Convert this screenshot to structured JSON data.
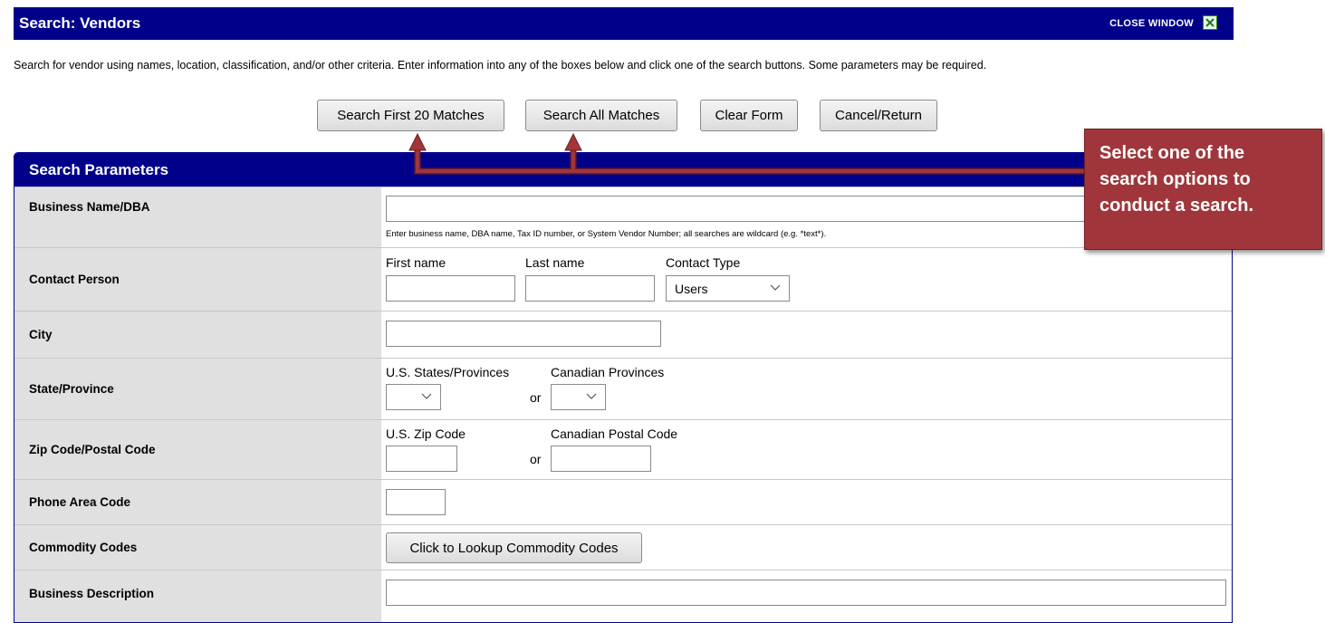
{
  "window": {
    "title": "Search: Vendors",
    "close_label": "CLOSE WINDOW",
    "close_icon": "close-x-icon"
  },
  "intro_text": "Search for vendor using names, location, classification, and/or other criteria. Enter information into any of the boxes below and click one of the search buttons. Some parameters may be required.",
  "buttons": {
    "search_first": "Search First 20 Matches",
    "search_all": "Search All Matches",
    "clear": "Clear Form",
    "cancel": "Cancel/Return"
  },
  "panel_title": "Search Parameters",
  "fields": {
    "business_name": {
      "label": "Business Name/DBA",
      "value": "",
      "hint": "Enter business name, DBA name, Tax ID number, or System Vendor Number; all searches are wildcard (e.g. *text*)."
    },
    "contact_person": {
      "label": "Contact Person",
      "first_caption": "First name",
      "last_caption": "Last name",
      "type_caption": "Contact Type",
      "type_value": "Users"
    },
    "city": {
      "label": "City",
      "value": ""
    },
    "state": {
      "label": "State/Province",
      "us_caption": "U.S. States/Provinces",
      "ca_caption": "Canadian Provinces",
      "or": "or"
    },
    "zip": {
      "label": "Zip Code/Postal Code",
      "us_caption": "U.S. Zip Code",
      "ca_caption": "Canadian Postal Code",
      "or": "or"
    },
    "phone": {
      "label": "Phone Area Code",
      "value": ""
    },
    "commodity": {
      "label": "Commodity Codes",
      "button": "Click to Lookup Commodity Codes"
    },
    "description": {
      "label": "Business Description",
      "value": ""
    }
  },
  "callout": {
    "lines": [
      "Select one of the",
      "search options to",
      "conduct a search."
    ]
  },
  "colors": {
    "header_blue": "#00008b",
    "callout_red": "#a0363b",
    "label_gray": "#e0e0e0"
  }
}
